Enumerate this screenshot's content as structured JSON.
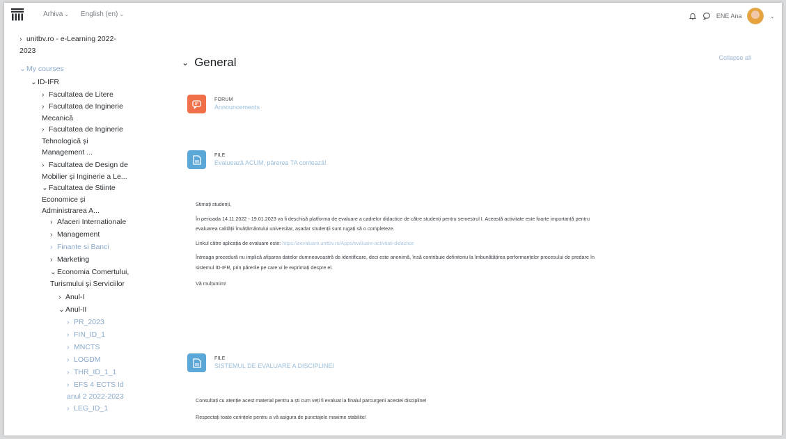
{
  "navbar": {
    "menu1": "Arhiva",
    "menu2": "English (en)",
    "user": "ENE Ana"
  },
  "sidebar": {
    "items": [
      {
        "label": "unitbv.ro - e-Learning 2022-\n2023",
        "caret": ">",
        "level": 0,
        "link": false
      },
      {
        "label": "My courses",
        "caret": "v",
        "level": 0,
        "link": true
      },
      {
        "label": "ID-IFR",
        "caret": "v",
        "level": 1,
        "link": false
      },
      {
        "label": "Facultatea de Litere",
        "caret": ">",
        "level": 2,
        "link": false
      },
      {
        "label": "Facultatea de Inginerie\nMecanică",
        "caret": ">",
        "level": 2,
        "link": false
      },
      {
        "label": "Facultatea de Inginerie\nTehnologică și\nManagement ...",
        "caret": ">",
        "level": 2,
        "link": false
      },
      {
        "label": "Facultatea de Design de\nMobilier și Inginerie a Le...",
        "caret": ">",
        "level": 2,
        "link": false
      },
      {
        "label": "Facultatea de Stiinte\nEconomice și\nAdministrarea A...",
        "caret": "v",
        "level": 2,
        "link": false
      },
      {
        "label": "Afaceri Internationale",
        "caret": ">",
        "level": 3,
        "link": false
      },
      {
        "label": "Management",
        "caret": ">",
        "level": 3,
        "link": false
      },
      {
        "label": "Finante si Banci",
        "caret": ">",
        "level": 3,
        "link": true
      },
      {
        "label": "Marketing",
        "caret": ">",
        "level": 3,
        "link": false
      },
      {
        "label": "Economia Comertului,\nTurismului și Serviciilor",
        "caret": "v",
        "level": 3,
        "link": false
      },
      {
        "label": "Anul-I",
        "caret": ">",
        "level": 4,
        "link": false
      },
      {
        "label": "Anul-II",
        "caret": "v",
        "level": 4,
        "link": false
      },
      {
        "label": "PR_2023",
        "caret": ">",
        "level": 5,
        "link": true
      },
      {
        "label": "FIN_ID_1",
        "caret": ">",
        "level": 5,
        "link": true
      },
      {
        "label": "MNCTS",
        "caret": ">",
        "level": 5,
        "link": true
      },
      {
        "label": "LOGDM",
        "caret": ">",
        "level": 5,
        "link": true
      },
      {
        "label": "THR_ID_1_1",
        "caret": ">",
        "level": 5,
        "link": true
      },
      {
        "label": "EFS 4 ECTS Id\nanul 2 2022-2023",
        "caret": ">",
        "level": 5,
        "link": true
      },
      {
        "label": "LEG_ID_1",
        "caret": ">",
        "level": 5,
        "link": true
      }
    ]
  },
  "main": {
    "section_title": "General",
    "collapse_all": "Collapse all",
    "forum": {
      "type": "FORUM",
      "name": "Announcements"
    },
    "file1": {
      "type": "FILE",
      "name": "Evaluează ACUM, părerea TA contează!"
    },
    "desc1": {
      "p1": "Stimați studenți,",
      "p2": "În perioada 14.11.2022 - 19.01.2023 va fi deschisă platforma de evaluare a cadrelor didactice de către studenți pentru semestrul I. Această activitate este foarte importantă pentru",
      "p2b": "evaluarea calității învățământului universitar, așadar studenții sunt rugați să o completeze.",
      "p3": "Linkul către aplicația de evaluare este:",
      "p3_link": "https://eevaluare.unitbv.ro/Apps/evaluare-activitati-didactice",
      "p4": "Întreaga procedură nu implică afișarea datelor dumneavoastră de identificare, deci este anonimă, însă contribuie definitoriu la îmbunătățirea performanțelor procesului de predare în",
      "p4b": "sistemul ID-IFR, prin părerile pe care vi le exprimați despre el.",
      "p5": "Vă mulțumim!"
    },
    "file2": {
      "type": "FILE",
      "name": "SISTEMUL DE EVALUARE A DISCIPLINEI"
    },
    "desc2": {
      "p1": "Consultați cu atenție acest material pentru a ști cum veți fi evaluat la finalul parcurgerii acestei discipline!",
      "p2": "Respectați toate cerințele pentru a vă asigura de punctajele maxime stabilite!"
    }
  },
  "colors": {
    "forum_icon": "#f0704a",
    "file_icon": "#5ba7d8",
    "link": "#8aa9cc"
  }
}
